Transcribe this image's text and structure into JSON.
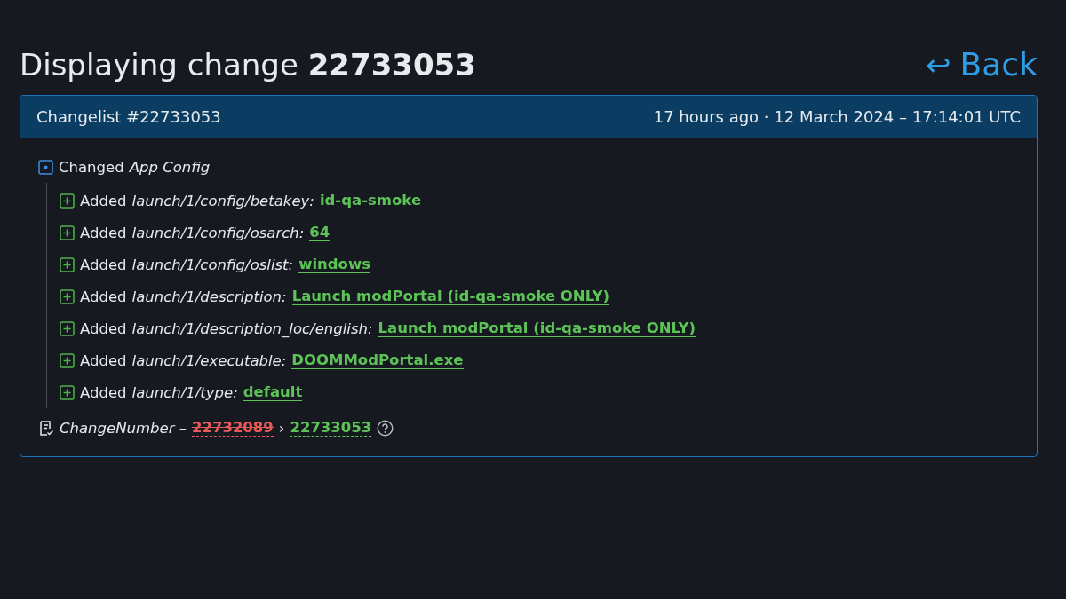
{
  "page_title": "Displaying change **22733053**",
  "back_link": {
    "arrow": "↩",
    "label": "Back"
  },
  "changelist": {
    "title": "Changelist #22733053",
    "timestamp": "17 hours ago · 12 March 2024 – 17:14:01 UTC",
    "group": {
      "kind": "changed",
      "verb": "Changed",
      "name": "App Config",
      "children": [
        {
          "kind": "added",
          "verb": "Added",
          "key": "launch/1/config/betakey:",
          "value": "id-qa-smoke"
        },
        {
          "kind": "added",
          "verb": "Added",
          "key": "launch/1/config/osarch:",
          "value": "64"
        },
        {
          "kind": "added",
          "verb": "Added",
          "key": "launch/1/config/oslist:",
          "value": "windows"
        },
        {
          "kind": "added",
          "verb": "Added",
          "key": "launch/1/description:",
          "value": "Launch modPortal (id-qa-smoke ONLY)"
        },
        {
          "kind": "added",
          "verb": "Added",
          "key": "launch/1/description_loc/english:",
          "value": "Launch modPortal (id-qa-smoke ONLY)"
        },
        {
          "kind": "added",
          "verb": "Added",
          "key": "launch/1/executable:",
          "value": "DOOMModPortal.exe"
        },
        {
          "kind": "added",
          "verb": "Added",
          "key": "launch/1/type:",
          "value": "default"
        }
      ]
    },
    "change_number": {
      "label": "ChangeNumber –",
      "old": "22732089",
      "separator": "›",
      "new": "22733053"
    }
  }
}
